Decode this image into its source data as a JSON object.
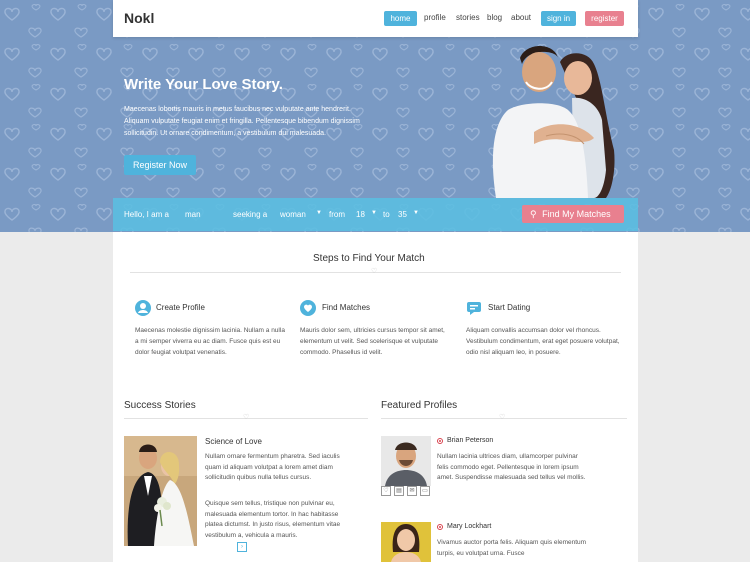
{
  "nav": {
    "logo": "Nokl",
    "links": [
      "home",
      "profile",
      "stories",
      "blog",
      "about"
    ],
    "sign_in": "sign in",
    "register": "register"
  },
  "hero": {
    "title": "Write Your Love Story.",
    "text": "Maecenas lobortis mauris in metus faucibus nec vulputate ante hendrerit. Aliquam vulputate feugiat enim et fringilla. Pellentesque bibendum dignissim sollicitudin. Ut ornare condimentum, a vestibulum dui malesuada.",
    "register_button": "Register Now"
  },
  "search": {
    "hello_label": "Hello, I am a",
    "gender_value": "man",
    "seeking_label": "seeking a",
    "seeking_value": "woman",
    "from_label": "from",
    "from_value": "18",
    "to_label": "to",
    "to_value": "35",
    "find_button": "Find My Matches"
  },
  "steps": {
    "title": "Steps to Find Your Match",
    "items": [
      {
        "title": "Create Profile",
        "icon": "user-icon",
        "text": "Maecenas molestie dignissim lacinia. Nullam a nulla a mi semper viverra eu ac diam. Fusce quis est eu dolor feugiat volutpat venenatis."
      },
      {
        "title": "Find Matches",
        "icon": "heart-icon",
        "text": "Mauris dolor sem, ultricies cursus tempor sit amet, elementum ut velit. Sed scelerisque et vulputate commodo. Phasellus id velit."
      },
      {
        "title": "Start Dating",
        "icon": "chat-icon",
        "text": "Aliquam convallis accumsan dolor vel rhoncus. Vestibulum condimentum, erat eget posuere volutpat, odio nisl aliquam leo, in posuere."
      }
    ]
  },
  "stories": {
    "title": "Success Stories",
    "story_title": "Science of Love",
    "paragraph1": "Nullam ornare fermentum pharetra. Sed iaculis quam id aliquam volutpat a lorem amet diam sollicitudin quibus nulla tellus cursus.",
    "paragraph2": "Quisque sem tellus, tristique non pulvinar eu, malesuada elementum tortor. In hac habitasse platea dictumst. In justo risus, elementum vitae vestibulum a, vehicula a mauris."
  },
  "profiles": {
    "title": "Featured Profiles",
    "items": [
      {
        "name": "Brian Peterson",
        "text": "Nullam lacinia ultrices diam, ullamcorper pulvinar felis commodo eget. Pellentesque in lorem ipsum amet. Suspendisse malesuada sed tellus vel mollis."
      },
      {
        "name": "Mary Lockhart",
        "text": "Vivamus auctor porta felis. Aliquam quis elementum turpis, eu volutpat urna. Fusce"
      }
    ]
  },
  "colors": {
    "hero_bg": "#7a9ac4",
    "accent_blue": "#4fb3dc",
    "accent_pink": "#e8808f"
  }
}
